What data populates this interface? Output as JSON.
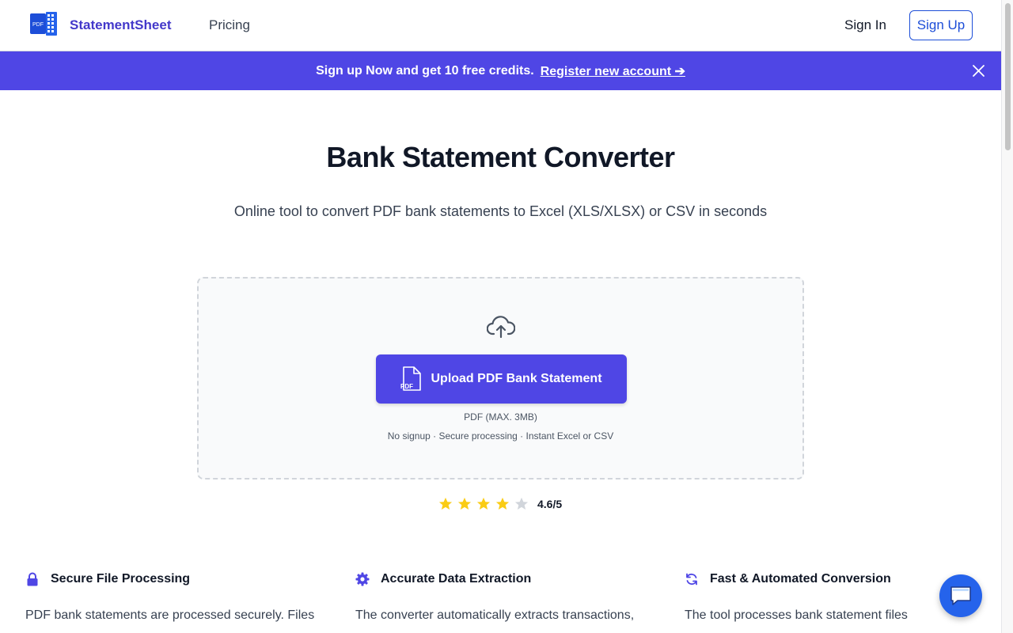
{
  "header": {
    "brand": "StatementSheet",
    "nav_pricing": "Pricing",
    "sign_in": "Sign In",
    "sign_up": "Sign Up"
  },
  "banner": {
    "text": "Sign up Now and get 10 free credits.",
    "link": "Register new account ➔"
  },
  "hero": {
    "title": "Bank Statement Converter",
    "subtitle": "Online tool to convert PDF bank statements to Excel (XLS/XLSX) or CSV in seconds"
  },
  "upload": {
    "button_label": "Upload PDF Bank Statement",
    "hint": "PDF (MAX. 3MB)",
    "features": "No signup · Secure processing · Instant Excel or CSV"
  },
  "rating": {
    "value": "4.6/5",
    "filled_stars": 4,
    "total_stars": 5
  },
  "features": [
    {
      "title": "Secure File Processing",
      "body": "PDF bank statements are processed securely. Files",
      "icon": "lock-icon"
    },
    {
      "title": "Accurate Data Extraction",
      "body": "The converter automatically extracts transactions,",
      "icon": "gear-icon"
    },
    {
      "title": "Fast & Automated Conversion",
      "body": "The tool processes bank statement files",
      "icon": "refresh-icon"
    }
  ],
  "colors": {
    "accent": "#4f46e5",
    "brand_text": "#4338ca",
    "star": "#facc15",
    "chat": "#2563eb"
  }
}
